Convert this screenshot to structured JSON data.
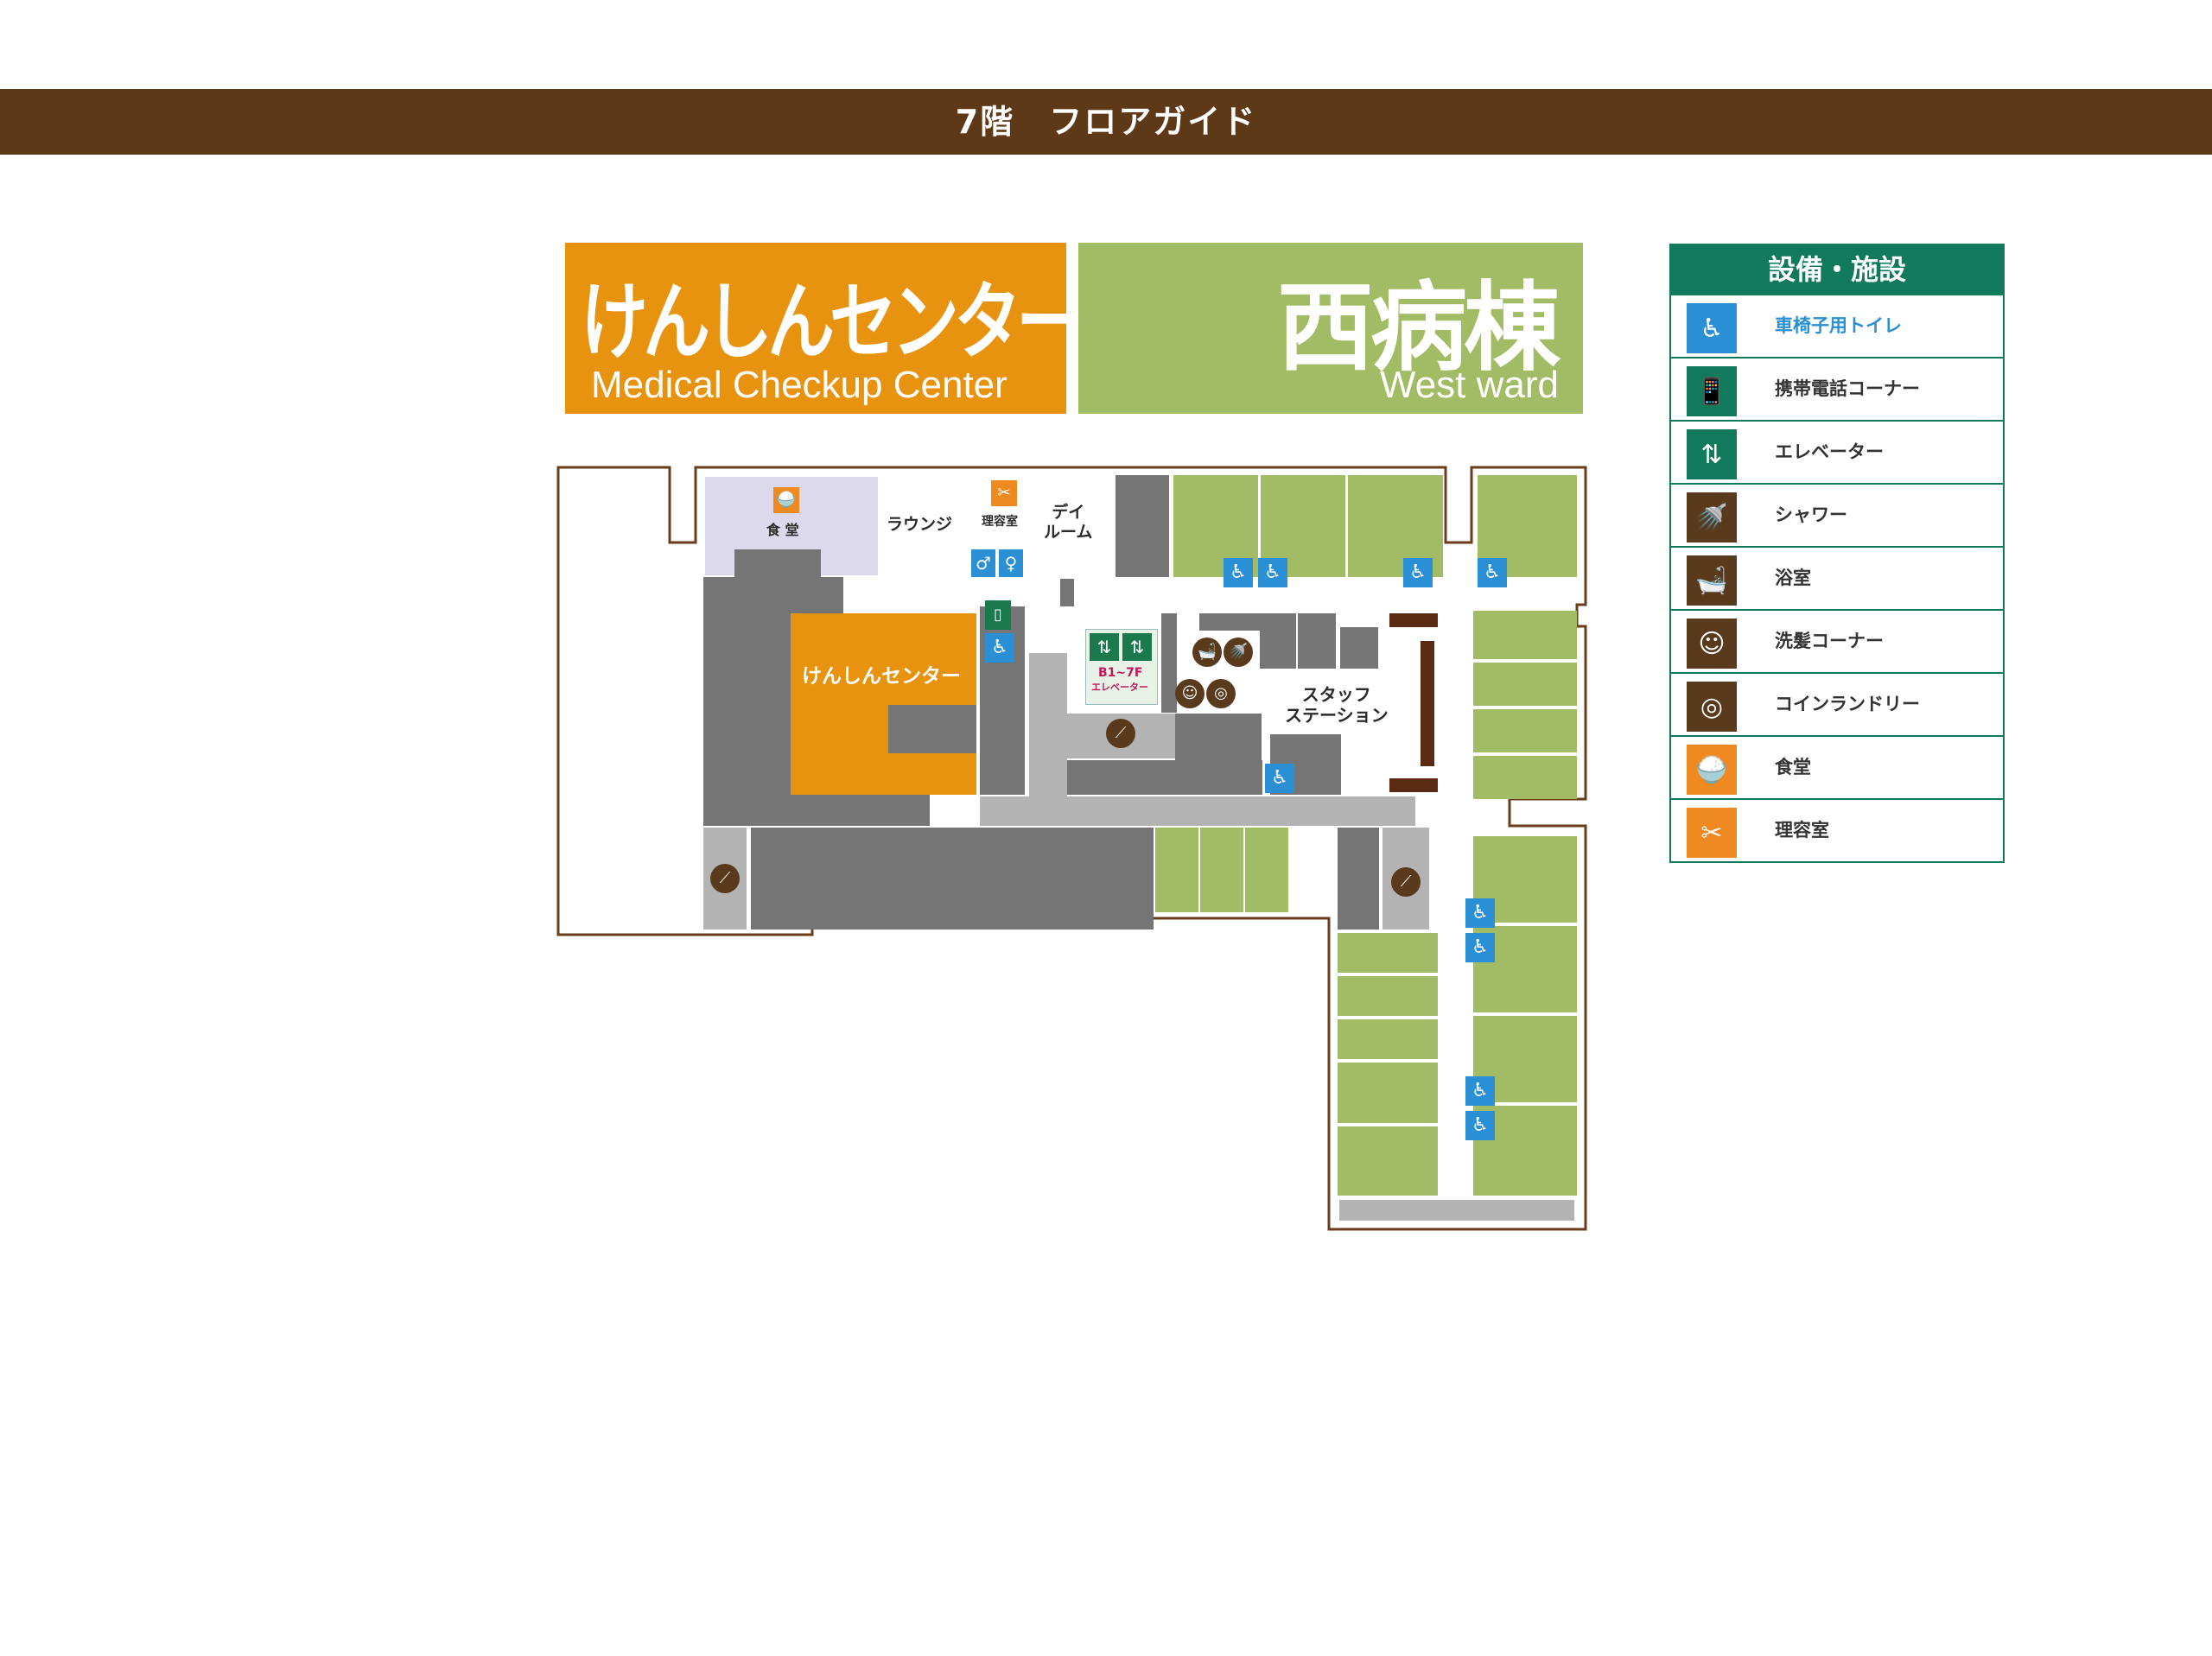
{
  "header": {
    "title": "7階　フロアガイド"
  },
  "banners": {
    "medical": {
      "jp": "けんしんセンター",
      "en": "Medical Checkup Center",
      "color": "#e8930f"
    },
    "west": {
      "jp": "西病棟",
      "en": "West ward",
      "color": "#a1bc64"
    }
  },
  "map": {
    "labels": {
      "cafeteria": "食 堂",
      "lounge": "ラウンジ",
      "barber": "理容室",
      "dayroom": "デイ\nルーム",
      "checkup": "けんしんセンター",
      "elevator_floors": "B1~7F",
      "elevator": "エレベーター",
      "staff": "スタッフ\nステーション"
    },
    "colors": {
      "wall": "#6a3c1a",
      "room": "#757575",
      "corridor": "#b3b3b3",
      "ward_room": "#a1bc64",
      "cafeteria": "#dcd9ec",
      "checkup": "#e8930f",
      "station_desk": "#5a2a12"
    }
  },
  "legend": {
    "title": "設備・施設",
    "items": [
      {
        "label": "車椅子用トイレ",
        "icon": "wheelchair-icon",
        "glyph": "♿",
        "color": "#2b8fd6",
        "text_color": "#2b8fd6"
      },
      {
        "label": "携帯電話コーナー",
        "icon": "mobile-phone-icon",
        "glyph": "📱",
        "color": "#127a5c",
        "text_color": "#333333"
      },
      {
        "label": "エレベーター",
        "icon": "elevator-icon",
        "glyph": "⇅",
        "color": "#127a5c",
        "text_color": "#333333"
      },
      {
        "label": "シャワー",
        "icon": "shower-icon",
        "glyph": "🚿",
        "color": "#5a3a1c",
        "text_color": "#333333"
      },
      {
        "label": "浴室",
        "icon": "bath-icon",
        "glyph": "🛁",
        "color": "#5a3a1c",
        "text_color": "#333333"
      },
      {
        "label": "洗髪コーナー",
        "icon": "hair-wash-icon",
        "glyph": "☺",
        "color": "#5a3a1c",
        "text_color": "#333333"
      },
      {
        "label": "コインランドリー",
        "icon": "laundry-icon",
        "glyph": "◎",
        "color": "#5a3a1c",
        "text_color": "#333333"
      },
      {
        "label": "食堂",
        "icon": "cafeteria-icon",
        "glyph": "🍚",
        "color": "#ef8a21",
        "text_color": "#333333"
      },
      {
        "label": "理容室",
        "icon": "barber-icon",
        "glyph": "✂",
        "color": "#ef8a21",
        "text_color": "#333333"
      }
    ]
  }
}
